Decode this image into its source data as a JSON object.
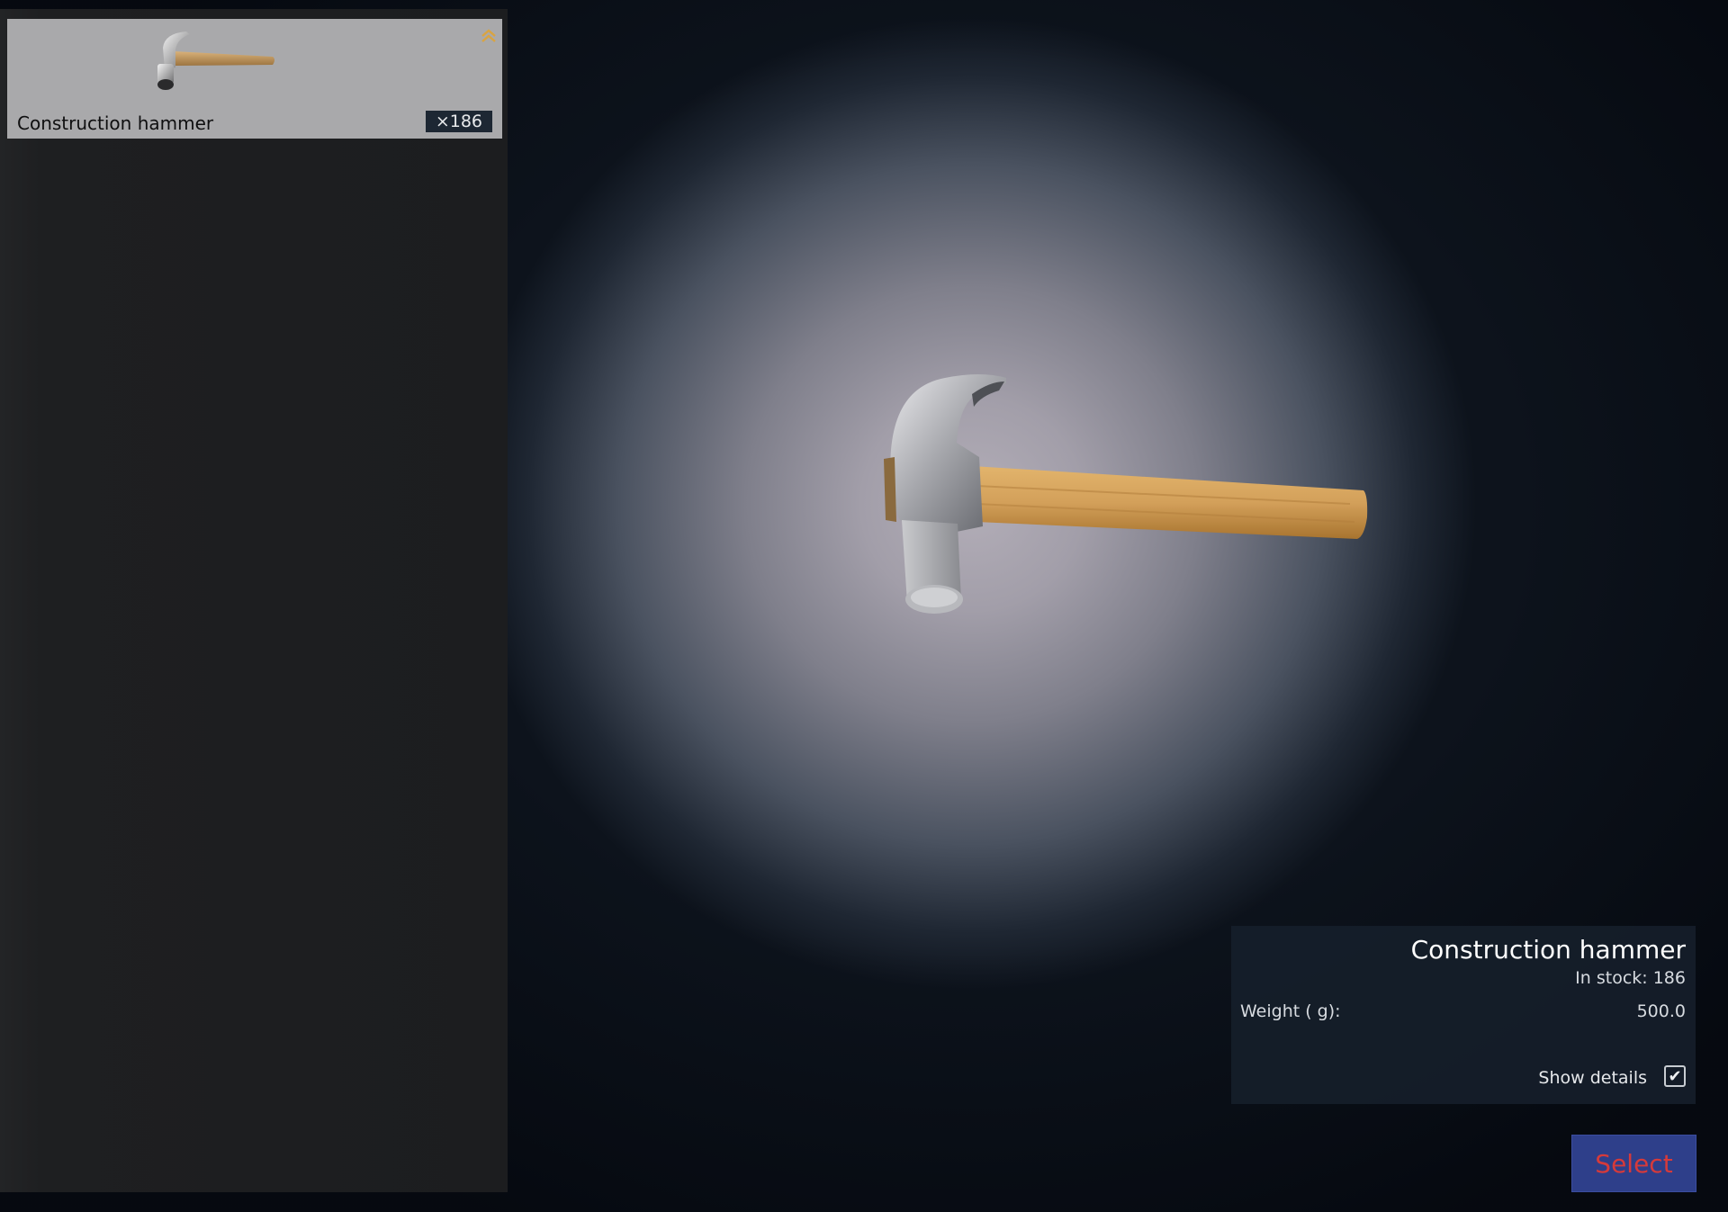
{
  "inventory": {
    "items": [
      {
        "name": "Construction hammer",
        "count": "×186",
        "icon": "hammer-icon",
        "rank_icon": "double-chevron-up-icon"
      }
    ]
  },
  "details": {
    "title": "Construction hammer",
    "stock": "In stock: 186",
    "weight_label": "Weight ( g):",
    "weight_value": "500.0",
    "show_details_label": "Show details",
    "show_details_checked": true
  },
  "actions": {
    "select_label": "Select"
  },
  "colors": {
    "select_bg": "#2e3f8a",
    "select_text": "#d63a3a",
    "slot_bg": "#a9a9ab",
    "rank_icon": "#d9a441"
  }
}
